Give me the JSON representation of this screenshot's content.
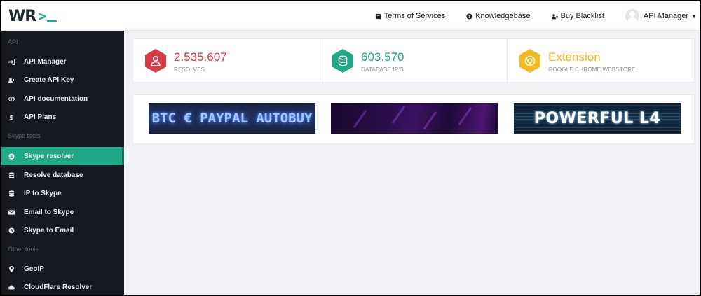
{
  "logo": {
    "text": "WR"
  },
  "nav": {
    "terms": "Terms of Services",
    "knowledgebase": "Knowledgebase",
    "buy_blacklist": "Buy Blacklist",
    "user": "API Manager"
  },
  "sidebar": {
    "section_api": "API",
    "api_manager": "API Manager",
    "create_api_key": "Create API Key",
    "api_documentation": "API documentation",
    "api_plans": "API Plans",
    "section_skype": "Skype tools",
    "skype_resolver": "Skype resolver",
    "resolve_database": "Resolve database",
    "ip_to_skype": "IP to Skype",
    "email_to_skype": "Email to Skype",
    "skype_to_email": "Skype to Email",
    "section_other": "Other tools",
    "geoip": "GeoIP",
    "cloudflare_resolver": "CloudFlare Resolver"
  },
  "stats": [
    {
      "value": "2.535.607",
      "label": "RESOLVES",
      "color": "#d63a45"
    },
    {
      "value": "603.570",
      "label": "DATABASE IP'S",
      "color": "#21a889"
    },
    {
      "value": "Extension",
      "label": "GOOGLE CHROME WEBSTORE",
      "color": "#f2b820"
    }
  ],
  "banners": {
    "b1": "BTC € PAYPAL AUTOBUY",
    "b3": "POWERFUL L4"
  },
  "colors": {
    "accent": "#21a889",
    "sidebar_bg": "#16191f",
    "page_bg": "#f1f2f6"
  }
}
